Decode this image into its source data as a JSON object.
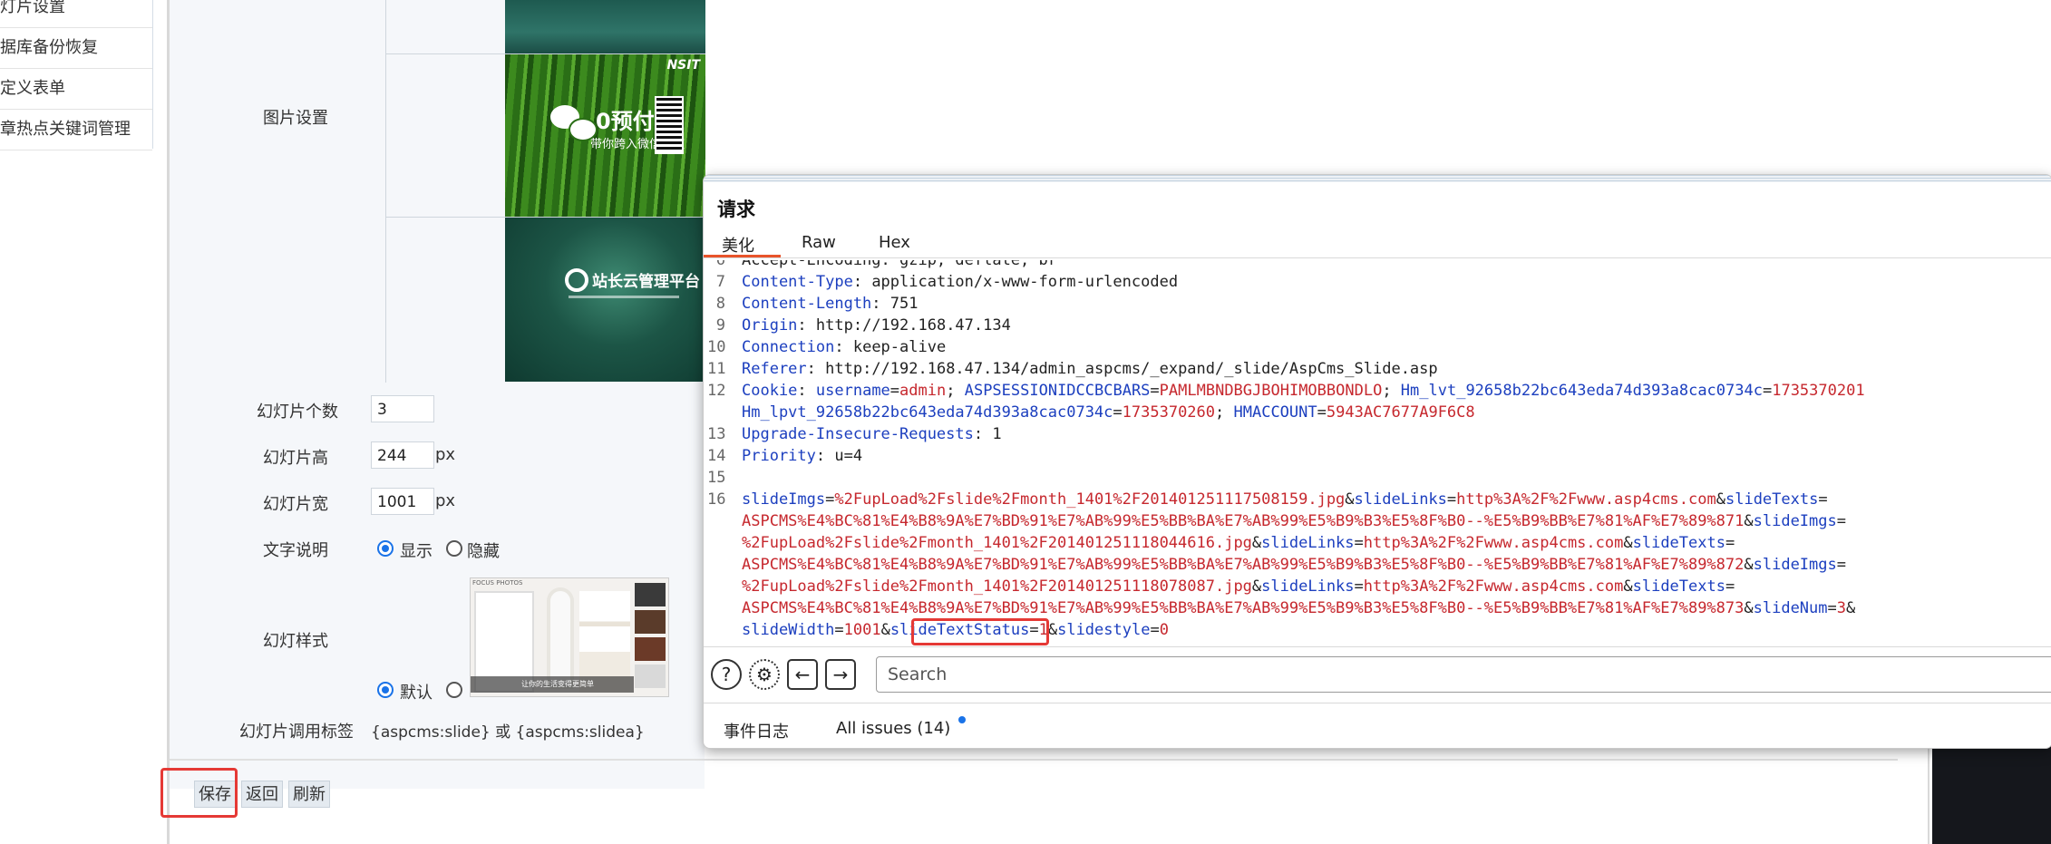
{
  "sidebar": {
    "items": [
      {
        "label": "幻灯片设置"
      },
      {
        "label": "数据库备份恢复"
      },
      {
        "label": "自定义表单"
      },
      {
        "label": "文章热点关键词管理"
      }
    ]
  },
  "form": {
    "image_setting_label": "图片设置",
    "slide_count_label": "幻灯片个数",
    "slide_count_value": "3",
    "slide_height_label": "幻灯片高",
    "slide_height_value": "244",
    "slide_height_unit": "px",
    "slide_width_label": "幻灯片宽",
    "slide_width_value": "1001",
    "slide_width_unit": "px",
    "text_desc_label": "文字说明",
    "show_label": "显示",
    "hide_label": "隐藏",
    "style_label": "幻灯样式",
    "default_label": "默认",
    "tag_label": "幻灯片调用标签",
    "tag_value": "{aspcms:slide} 或 {aspcms:slidea}",
    "images": [
      {
        "brand": "",
        "text1": ""
      },
      {
        "brand": "NSIT",
        "text1": "0预付",
        "text2": "带你跨入微信门槛"
      },
      {
        "brand": "",
        "text1": "站长云管理平台"
      }
    ],
    "style_thumb_caption": "让你的生活变得更简单",
    "style_thumb_brand": "FOCUS PHOTOS"
  },
  "buttons": {
    "save": "保存",
    "back": "返回",
    "refresh": "刷新"
  },
  "burp": {
    "title": "请求",
    "tabs": [
      "美化",
      "Raw",
      "Hex"
    ],
    "lines": [
      {
        "n": "6",
        "text": "Accept-Encoding: gzip, deflate, br"
      },
      {
        "n": "7",
        "key": "Content-Type",
        "val": "application/x-www-form-urlencoded"
      },
      {
        "n": "8",
        "key": "Content-Length",
        "val": "751"
      },
      {
        "n": "9",
        "key": "Origin",
        "val": "http://192.168.47.134"
      },
      {
        "n": "10",
        "key": "Connection",
        "val": "keep-alive"
      },
      {
        "n": "11",
        "key": "Referer",
        "val": "http://192.168.47.134/admin_aspcms/_expand/_slide/AspCms_Slide.asp"
      },
      {
        "n": "12",
        "key": "Cookie",
        "val": ""
      },
      {
        "n": "13",
        "key": "Upgrade-Insecure-Requests",
        "val": "1"
      },
      {
        "n": "14",
        "key": "Priority",
        "val": "u=4"
      },
      {
        "n": "15",
        "text": ""
      },
      {
        "n": "16",
        "text": ""
      }
    ],
    "cookie_line1": [
      {
        "k": "username",
        "v": "admin"
      },
      {
        "k": "ASPSESSIONIDCCBCBARS",
        "v": "PAMLMBNDBGJBOHIMOBBONDLO"
      },
      {
        "k": "Hm_lvt_92658b22bc643eda74d393a8cac0734c",
        "v": "1735370201"
      }
    ],
    "cookie_line2": [
      {
        "k": "Hm_lpvt_92658b22bc643eda74d393a8cac0734c",
        "v": "1735370260"
      },
      {
        "k": "HMACCOUNT",
        "v": "5943AC7677A9F6C8"
      }
    ],
    "body_rows": [
      {
        "k1": "slideImgs",
        "v1": "%2FupLoad%2Fslide%2Fmonth_1401%2F201401251117508159.jpg",
        "k2": "slideLinks",
        "v2": "http%3A%2F%2Fwww.asp4cms.com",
        "k3": "slideTexts",
        "v3": ""
      },
      {
        "pre": "ASPCMS%E4%BC%81%E4%B8%9A%E7%BD%91%E7%AB%99%E5%BB%BA%E7%AB%99%E5%B9%B3%E5%8F%B0--%E5%B9%BB%E7%81%AF%E7%89%871",
        "k": "slideImgs",
        "v": ""
      },
      {
        "k1": "",
        "v1": "%2FupLoad%2Fslide%2Fmonth_1401%2F201401251118044616.jpg",
        "k2": "slideLinks",
        "v2": "http%3A%2F%2Fwww.asp4cms.com",
        "k3": "slideTexts",
        "v3": ""
      },
      {
        "pre": "ASPCMS%E4%BC%81%E4%B8%9A%E7%BD%91%E7%AB%99%E5%BB%BA%E7%AB%99%E5%B9%B3%E5%8F%B0--%E5%B9%BB%E7%81%AF%E7%89%872",
        "k": "slideImgs",
        "v": ""
      },
      {
        "k1": "",
        "v1": "%2FupLoad%2Fslide%2Fmonth_1401%2F201401251118078087.jpg",
        "k2": "slideLinks",
        "v2": "http%3A%2F%2Fwww.asp4cms.com",
        "k3": "slideTexts",
        "v3": ""
      },
      {
        "pre": "ASPCMS%E4%BC%81%E4%B8%9A%E7%BD%91%E7%AB%99%E5%BB%BA%E7%AB%99%E5%B9%B3%E5%8F%B0--%E5%B9%BB%E7%81%AF%E7%89%873",
        "k": "slideNum",
        "v": "3"
      },
      {
        "k1": "slideWidth",
        "v1": "1001",
        "k2": "slideTextStatus",
        "v2": "1",
        "k3": "slidestyle",
        "v3": "0"
      }
    ],
    "search_placeholder": "Search",
    "footer_log": "事件日志",
    "footer_issues": "All issues (14)"
  }
}
